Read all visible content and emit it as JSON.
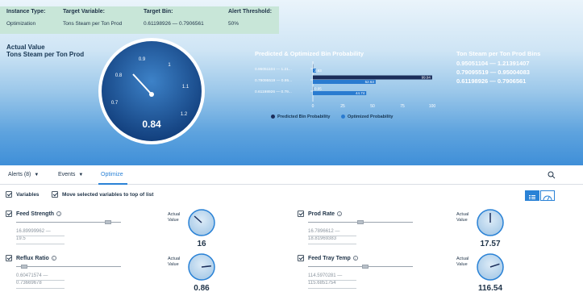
{
  "info": {
    "instance_type_label": "Instance Type:",
    "instance_type_value": "Optimization",
    "target_variable_label": "Target Variable:",
    "target_variable_value": "Tons Steam per Ton Prod",
    "target_bin_label": "Target Bin:",
    "target_bin_value": "0.61198926 — 0.7906561",
    "alert_threshold_label": "Alert Threshold:",
    "alert_threshold_value": "50%"
  },
  "actual": {
    "title_line1": "Actual Value",
    "title_line2": "Tons Steam per Ton Prod",
    "gauge_value": "0.84",
    "gauge_ticks": [
      "0.7",
      "0.8",
      "0.9",
      "1",
      "1.1",
      "1.2"
    ]
  },
  "chart": {
    "title": "Predicted & Optimized Bin Probability"
  },
  "chart_data": {
    "type": "bar",
    "orientation": "horizontal",
    "categories": [
      "0.95051104 — 1.21...",
      "0.79095519 — 0.95...",
      "0.61198926 — 0.79..."
    ],
    "series": [
      {
        "name": "Predicted Bin Probability",
        "values": [
          0,
          99.94,
          0.05
        ],
        "color": "#1b2d5a"
      },
      {
        "name": "Optimized Probability",
        "values": [
          2.63,
          52.63,
          44.74
        ],
        "color": "#2a7bd0"
      }
    ],
    "data_labels": [
      "2.63",
      "99.94",
      "52.63",
      "0.05",
      "44.74"
    ],
    "x_ticks": [
      "0",
      "25",
      "50",
      "75",
      "100"
    ],
    "xlim": [
      0,
      100
    ],
    "legend_position": "bottom"
  },
  "bins": {
    "title": "Ton Steam per Ton Prod Bins",
    "rows": [
      "0.95051104 — 1.21391407",
      "0.79095519 — 0.95004083",
      "0.61198926 — 0.7906561"
    ]
  },
  "tabs": {
    "alerts": "Alerts (8)",
    "events": "Events",
    "optimize": "Optimize"
  },
  "options": {
    "variables": "Variables",
    "move_selected": "Move selected variables to top of list"
  },
  "variables": [
    {
      "name": "Feed Strength",
      "range_low": "16.89999962 —",
      "range_high": "19.5",
      "actual_label_1": "Actual",
      "actual_label_2": "Value",
      "actual_value": "16",
      "slider_level": 0.9,
      "gauge_level": 0.3
    },
    {
      "name": "Prod Rate",
      "range_low": "16.7896612 —",
      "range_high": "18.81969383",
      "actual_label_1": "Actual",
      "actual_label_2": "Value",
      "actual_value": "17.57",
      "slider_level": 0.5,
      "gauge_level": 0.5
    },
    {
      "name": "Reflux Ratio",
      "range_low": "0.60471574 —",
      "range_high": "0.73669678",
      "actual_label_1": "Actual",
      "actual_label_2": "Value",
      "actual_value": "0.86",
      "slider_level": 0.05,
      "gauge_level": 0.85
    },
    {
      "name": "Feed Tray Temp",
      "range_low": "114.5970281 —",
      "range_high": "115.6851754",
      "actual_label_1": "Actual",
      "actual_label_2": "Value",
      "actual_value": "116.54",
      "slider_level": 0.55,
      "gauge_level": 0.8
    }
  ],
  "icons": {
    "info": "info-icon",
    "search": "search-icon",
    "list_view": "list-view-icon",
    "gauge_view": "gauge-view-icon"
  },
  "colors": {
    "accent": "#2a82d6",
    "predicted": "#1b2d5a",
    "optimized": "#2a7bd0"
  }
}
